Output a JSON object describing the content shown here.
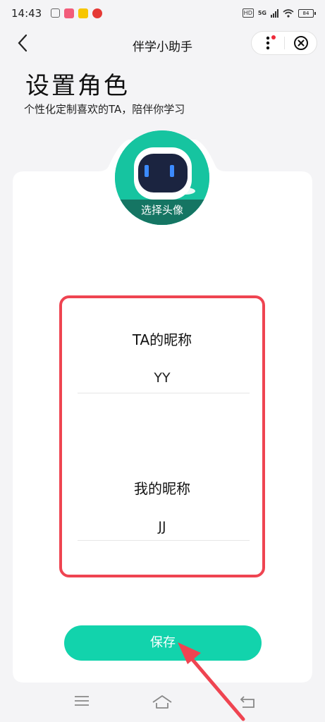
{
  "status_bar": {
    "time": "14:43",
    "hd": "HD",
    "network": "5G",
    "battery": "84"
  },
  "nav": {
    "title": "伴学小助手"
  },
  "header": {
    "title": "设置角色",
    "subtitle": "个性化定制喜欢的TA，陪伴你学习"
  },
  "avatar": {
    "label": "选择头像"
  },
  "form": {
    "ta_nickname_label": "TA的昵称",
    "ta_nickname_value": "YY",
    "my_nickname_label": "我的昵称",
    "my_nickname_value": "JJ"
  },
  "actions": {
    "save_label": "保存"
  },
  "colors": {
    "accent": "#12d3ac",
    "highlight_border": "#ef4451",
    "avatar_bg": "#16c4a0"
  }
}
